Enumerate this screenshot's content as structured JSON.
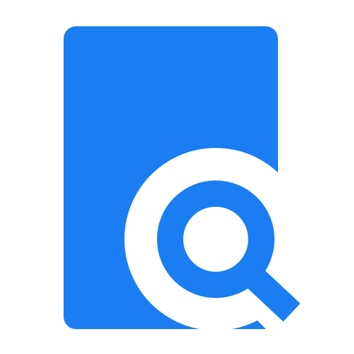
{
  "icon": {
    "name": "document-search-icon",
    "parts": [
      "document-icon",
      "magnifier-icon"
    ]
  },
  "colors": {
    "accent": "#1a7df2",
    "background": "#ffffff"
  }
}
